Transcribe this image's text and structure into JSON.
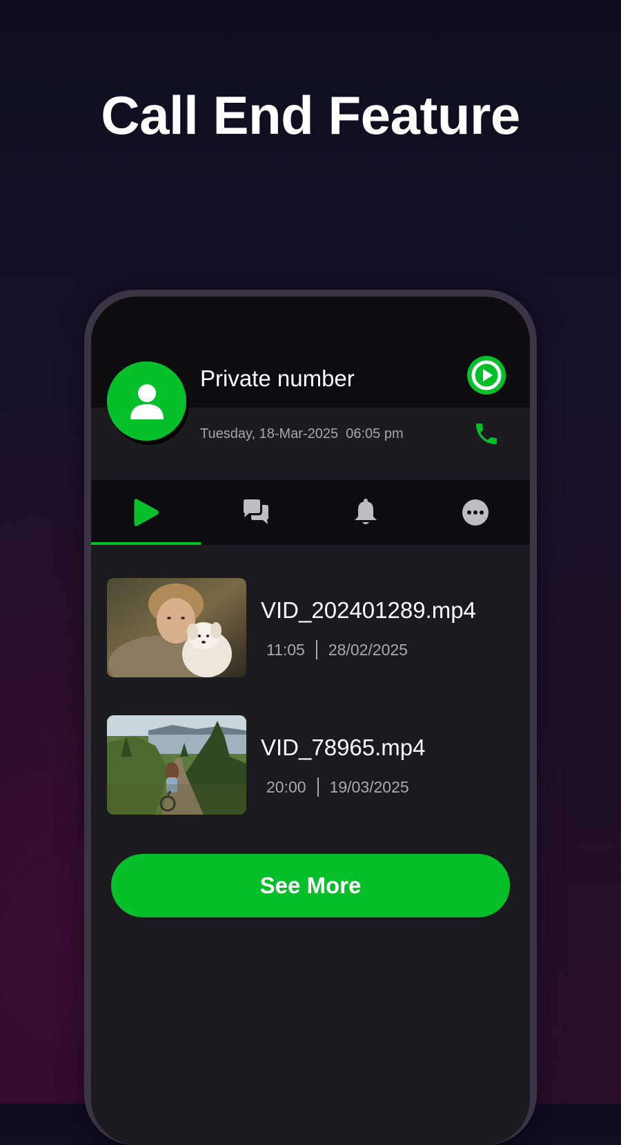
{
  "headline": "Call End Feature",
  "caller": {
    "name": "Private number",
    "date": "Tuesday, 18-Mar-2025",
    "time": "06:05 pm"
  },
  "header_icons": [
    "play-circle-icon",
    "phone-icon"
  ],
  "tabs": [
    {
      "icon": "play-icon",
      "active": true
    },
    {
      "icon": "chat-icon",
      "active": false
    },
    {
      "icon": "bell-icon",
      "active": false
    },
    {
      "icon": "more-icon",
      "active": false
    }
  ],
  "videos": [
    {
      "title": "VID_202401289.mp4",
      "duration": "11:05",
      "date": "28/02/2025"
    },
    {
      "title": "VID_78965.mp4",
      "duration": "20:00",
      "date": "19/03/2025"
    }
  ],
  "see_more_label": "See More",
  "colors": {
    "accent": "#05c02a",
    "screen": "#1b1b1f",
    "header": "#0d0d10"
  }
}
